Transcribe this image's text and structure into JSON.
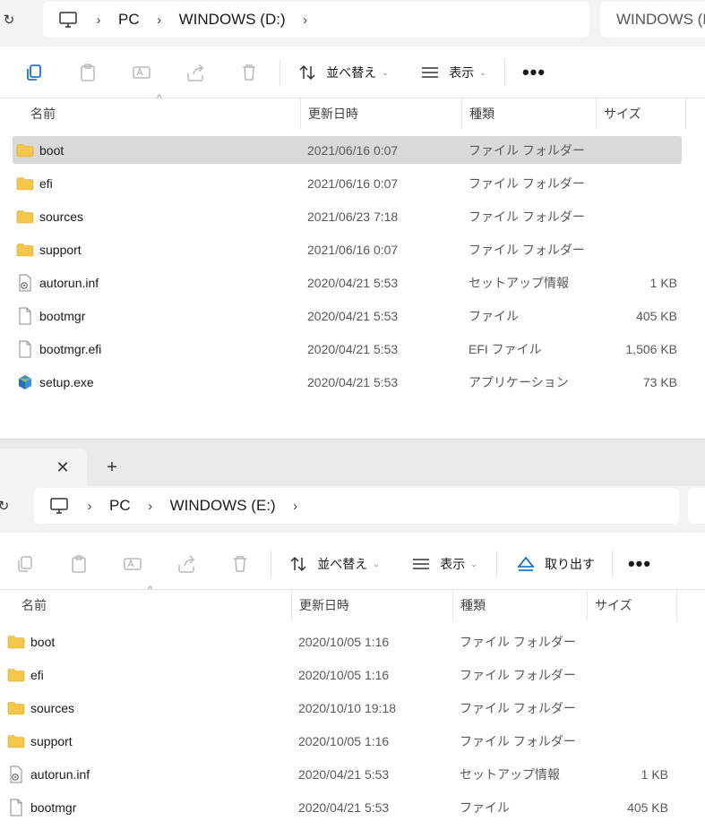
{
  "window1": {
    "breadcrumb": [
      "PC",
      "WINDOWS (D:)"
    ],
    "search_text": "WINDOWS (D:)",
    "toolbar": {
      "sort_label": "並べ替え",
      "view_label": "表示",
      "more_label": "•••"
    },
    "columns": {
      "name": "名前",
      "date": "更新日時",
      "type": "種類",
      "size": "サイズ"
    },
    "rows": [
      {
        "name": "boot",
        "date": "2021/06/16 0:07",
        "type": "ファイル フォルダー",
        "size": "",
        "icon": "folder-icon",
        "selected": true
      },
      {
        "name": "efi",
        "date": "2021/06/16 0:07",
        "type": "ファイル フォルダー",
        "size": "",
        "icon": "folder-icon"
      },
      {
        "name": "sources",
        "date": "2021/06/23 7:18",
        "type": "ファイル フォルダー",
        "size": "",
        "icon": "folder-icon"
      },
      {
        "name": "support",
        "date": "2021/06/16 0:07",
        "type": "ファイル フォルダー",
        "size": "",
        "icon": "folder-icon"
      },
      {
        "name": "autorun.inf",
        "date": "2020/04/21 5:53",
        "type": "セットアップ情報",
        "size": "1 KB",
        "icon": "setup-info-icon"
      },
      {
        "name": "bootmgr",
        "date": "2020/04/21 5:53",
        "type": "ファイル",
        "size": "405 KB",
        "icon": "file-icon"
      },
      {
        "name": "bootmgr.efi",
        "date": "2020/04/21 5:53",
        "type": "EFI ファイル",
        "size": "1,506 KB",
        "icon": "file-icon"
      },
      {
        "name": "setup.exe",
        "date": "2020/04/21 5:53",
        "type": "アプリケーション",
        "size": "73 KB",
        "icon": "setup-exe-icon"
      }
    ]
  },
  "window2": {
    "tab": {
      "close": "✕",
      "add": "+"
    },
    "breadcrumb": [
      "PC",
      "WINDOWS (E:)"
    ],
    "toolbar": {
      "sort_label": "並べ替え",
      "view_label": "表示",
      "eject_label": "取り出す",
      "more_label": "•••"
    },
    "columns": {
      "name": "名前",
      "date": "更新日時",
      "type": "種類",
      "size": "サイズ"
    },
    "rows": [
      {
        "name": "boot",
        "date": "2020/10/05 1:16",
        "type": "ファイル フォルダー",
        "size": "",
        "icon": "folder-icon"
      },
      {
        "name": "efi",
        "date": "2020/10/05 1:16",
        "type": "ファイル フォルダー",
        "size": "",
        "icon": "folder-icon"
      },
      {
        "name": "sources",
        "date": "2020/10/10 19:18",
        "type": "ファイル フォルダー",
        "size": "",
        "icon": "folder-icon"
      },
      {
        "name": "support",
        "date": "2020/10/05 1:16",
        "type": "ファイル フォルダー",
        "size": "",
        "icon": "folder-icon"
      },
      {
        "name": "autorun.inf",
        "date": "2020/04/21 5:53",
        "type": "セットアップ情報",
        "size": "1 KB",
        "icon": "setup-info-icon"
      },
      {
        "name": "bootmgr",
        "date": "2020/04/21 5:53",
        "type": "ファイル",
        "size": "405 KB",
        "icon": "file-icon"
      }
    ]
  },
  "colors": {
    "folder": "#f4c74a",
    "selection": "#d9d9d9",
    "accent": "#0067c0"
  }
}
